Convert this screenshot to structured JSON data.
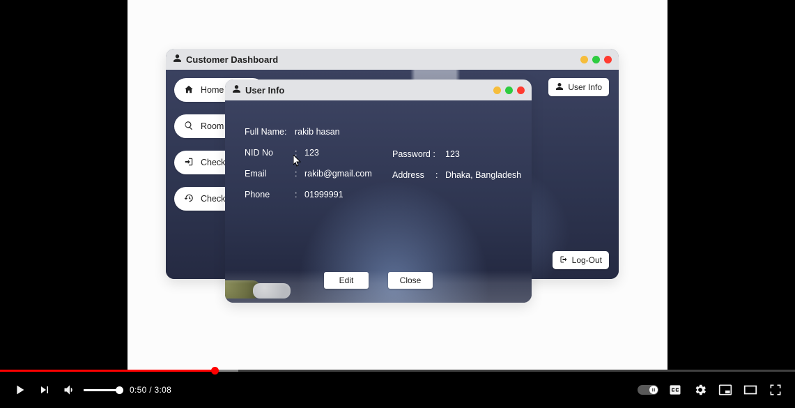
{
  "player": {
    "current_time": "0:50",
    "duration": "3:08",
    "played_fraction": 0.27,
    "loaded_fraction": 0.3
  },
  "dashboard": {
    "title": "Customer Dashboard",
    "sidebar": {
      "home": "Home",
      "room": "Room ",
      "checkin": "Check-",
      "checkout": "Check "
    },
    "user_info_btn": "User Info",
    "logout_btn": "Log-Out"
  },
  "userinfo": {
    "title": "User Info",
    "labels": {
      "fullname": "Full Name:",
      "nid": "NID No",
      "email": "Email",
      "phone": "Phone",
      "password": "Password :",
      "address": "Address"
    },
    "values": {
      "fullname": "rakib hasan",
      "nid": "123",
      "email": "rakib@gmail.com",
      "phone": "01999991",
      "password": "123",
      "address": "Dhaka, Bangladesh"
    },
    "buttons": {
      "edit": "Edit",
      "close": "Close"
    }
  }
}
